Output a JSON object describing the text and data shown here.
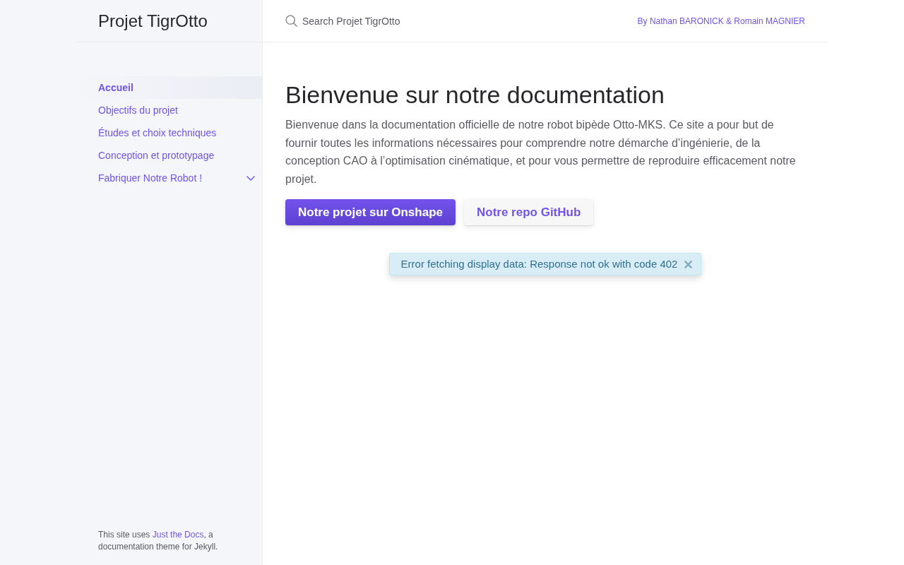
{
  "sidebar": {
    "title": "Projet TigrOtto",
    "nav": [
      {
        "label": "Accueil",
        "selected": true
      },
      {
        "label": "Objectifs du projet",
        "selected": false
      },
      {
        "label": "Études et choix techniques",
        "selected": false
      },
      {
        "label": "Conception et prototypage",
        "selected": false
      },
      {
        "label": "Fabriquer Notre Robot !",
        "selected": false,
        "expanded": false
      }
    ],
    "footer": {
      "before": "This site uses ",
      "link": "Just the Docs",
      "after": ", a documentation theme for Jekyll."
    }
  },
  "header": {
    "search": {
      "placeholder": "Search Projet TigrOtto"
    },
    "author_link": "By Nathan BARONICK & Romain MAGNIER"
  },
  "main": {
    "heading": "Bienvenue sur notre documentation",
    "paragraph": "Bienvenue dans la documentation officielle de notre robot bipède Otto-MKS. Ce site a pour but de fournir toutes les informations nécessaires pour comprendre notre démarche d’ingénierie, de la conception CAO à l’optimisation cinématique, et pour vous permettre de reproduire efficacement notre projet.",
    "buttons": [
      {
        "label": "Notre projet sur Onshape",
        "kind": "primary"
      },
      {
        "label": "Notre repo GitHub",
        "kind": "secondary"
      }
    ],
    "alert": {
      "message": "Error fetching display data: Response not ok with code 402"
    }
  }
}
